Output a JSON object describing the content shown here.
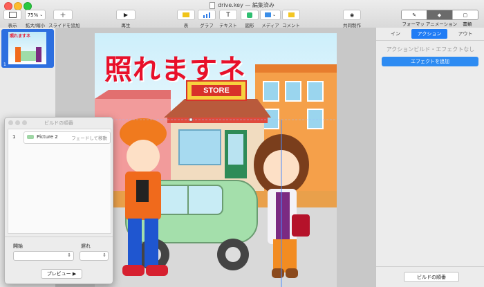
{
  "window": {
    "title": "drive.key — 編集済み"
  },
  "toolbar": {
    "view_label": "表示",
    "zoom_value": "75%",
    "zoom_label": "拡大/縮小",
    "add_slide_label": "スライドを追加",
    "play_label": "再生",
    "table_label": "表",
    "chart_label": "グラフ",
    "text_label": "テキスト",
    "shape_label": "図形",
    "media_label": "メディア",
    "comment_label": "コメント",
    "collaborate_label": "共同制作",
    "format_label": "フォーマット",
    "animate_label": "アニメーション",
    "document_label": "書類"
  },
  "navigator": {
    "slide_number": "1"
  },
  "slide": {
    "headline": "照れますネ",
    "store_sign": "STORE"
  },
  "inspector": {
    "tabs": [
      "イン",
      "アクション",
      "アウト"
    ],
    "active_tab": "アクション",
    "empty_message": "アクションビルド・エフェクトなし",
    "add_effect_button": "エフェクトを追加",
    "build_order_button": "ビルドの順番"
  },
  "build_order_window": {
    "title": "ビルドの順番",
    "items": [
      {
        "number": "1",
        "name": "Picture 2",
        "effect": "フェードして移動"
      }
    ],
    "start_label": "開始",
    "delay_label": "遅れ",
    "preview_button": "プレビュー ▶"
  },
  "colors": {
    "accent": "#2d6fe0",
    "headline": "#e8102a",
    "active_tab": "#1f7cf5"
  }
}
